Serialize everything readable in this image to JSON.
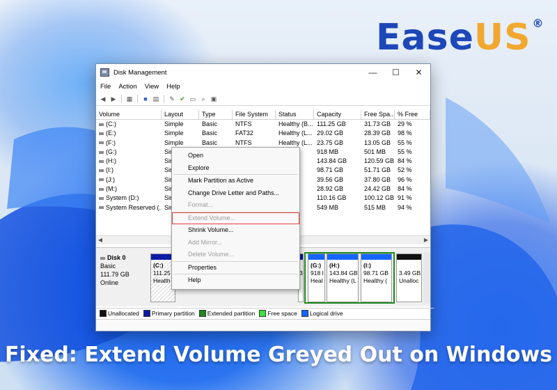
{
  "brand": {
    "ease": "Ease",
    "us": "US",
    "reg": "®"
  },
  "headline": "Fixed: Extend Volume Greyed Out on Windows",
  "window": {
    "title": "Disk Management",
    "controls": {
      "minimize": "—",
      "maximize": "☐",
      "close": "✕"
    },
    "menu": [
      "File",
      "Action",
      "View",
      "Help"
    ]
  },
  "table": {
    "headers": [
      "Volume",
      "Layout",
      "Type",
      "File System",
      "Status",
      "Capacity",
      "Free Spa...",
      "% Free"
    ],
    "rows": [
      [
        "(C:)",
        "Simple",
        "Basic",
        "NTFS",
        "Healthy (B...",
        "111.25 GB",
        "31.73 GB",
        "29 %"
      ],
      [
        "(E:)",
        "Simple",
        "Basic",
        "FAT32",
        "Healthy (L...",
        "29.02 GB",
        "28.39 GB",
        "98 %"
      ],
      [
        "(F:)",
        "Simple",
        "Basic",
        "NTFS",
        "Healthy (L...",
        "23.75 GB",
        "13.05 GB",
        "55 %"
      ],
      [
        "(G:)",
        "Sir",
        "",
        "",
        "(L...",
        "918 MB",
        "501 MB",
        "55 %"
      ],
      [
        "(H:)",
        "Sir",
        "",
        "",
        "(L...",
        "143.84 GB",
        "120.59 GB",
        "84 %"
      ],
      [
        "(I:)",
        "Sir",
        "",
        "",
        "(L...",
        "98.71 GB",
        "51.71 GB",
        "52 %"
      ],
      [
        "(J:)",
        "Sir",
        "",
        "",
        "(P...",
        "39.56 GB",
        "37.80 GB",
        "96 %"
      ],
      [
        "(M:)",
        "Sir",
        "",
        "",
        "(P...",
        "28.92 GB",
        "24.42 GB",
        "84 %"
      ],
      [
        "System (D:)",
        "Sir",
        "",
        "",
        "(P...",
        "110.16 GB",
        "100.12 GB",
        "91 %"
      ],
      [
        "System Reserved (...",
        "Sir",
        "",
        "",
        "(S...",
        "549 MB",
        "515 MB",
        "94 %"
      ]
    ]
  },
  "disk": {
    "name": "Disk 0",
    "type": "Basic",
    "size": "111.79 GB",
    "status": "Online"
  },
  "partitions": [
    {
      "name": "(C:)",
      "size": "111.25",
      "status": "Health"
    },
    {
      "name": "(G:)",
      "size": "918 I",
      "status": "Heal"
    },
    {
      "name": "(H:)",
      "size": "143.84 GB",
      "status": "Healthy (L"
    },
    {
      "name": "(I:)",
      "size": "98.71 GB",
      "status": "Healthy ("
    },
    {
      "name": "",
      "size": "3.49 GB",
      "status": "Unalloc"
    }
  ],
  "partition_fragment": "3",
  "legend": [
    {
      "label": "Unallocated",
      "color": "#111111"
    },
    {
      "label": "Primary partition",
      "color": "#0c1aa8"
    },
    {
      "label": "Extended partition",
      "color": "#1e8a1e"
    },
    {
      "label": "Free space",
      "color": "#3ee03e"
    },
    {
      "label": "Logical drive",
      "color": "#1565ff"
    }
  ],
  "context_menu": {
    "open": "Open",
    "explore": "Explore",
    "mark_active": "Mark Partition as Active",
    "change_letter": "Change Drive Letter and Paths...",
    "format": "Format...",
    "extend": "Extend Volume...",
    "shrink": "Shrink Volume...",
    "add_mirror": "Add Mirror...",
    "delete": "Delete Volume...",
    "properties": "Properties",
    "help": "Help"
  }
}
